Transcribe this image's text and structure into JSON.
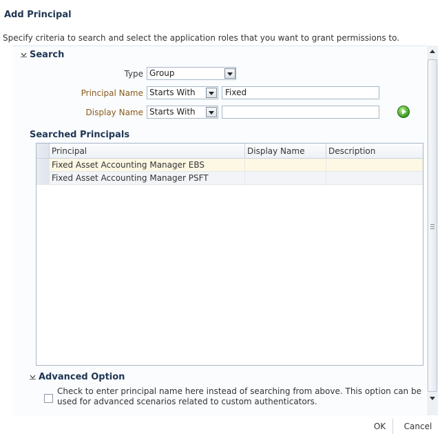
{
  "dialog": {
    "title": "Add Principal",
    "instruction": "Specify criteria to search and select the application roles that you want to grant permissions to."
  },
  "search": {
    "header": "Search",
    "type_label": "Type",
    "type_value": "Group",
    "principal_name_label": "Principal Name",
    "principal_name_operator": "Starts With",
    "principal_name_value": "Fixed",
    "display_name_label": "Display Name",
    "display_name_operator": "Starts With",
    "display_name_value": "",
    "go_icon": "go-arrow-icon"
  },
  "results": {
    "header": "Searched Principals",
    "columns": [
      "Principal",
      "Display Name",
      "Description"
    ],
    "rows": [
      {
        "principal": "Fixed Asset Accounting Manager EBS",
        "display_name": "",
        "description": ""
      },
      {
        "principal": "Fixed Asset Accounting Manager PSFT",
        "display_name": "",
        "description": ""
      }
    ]
  },
  "advanced": {
    "header": "Advanced Option",
    "checkbox_text": "Check to enter principal name here instead of searching from above. This option can be used for advanced scenarios related to custom authenticators.",
    "checked": false
  },
  "footer": {
    "ok_label": "OK",
    "cancel_label": "Cancel"
  },
  "colors": {
    "title": "#1f3552",
    "selected_row": "#fdf8e4",
    "go_button": "#3ea12a"
  }
}
